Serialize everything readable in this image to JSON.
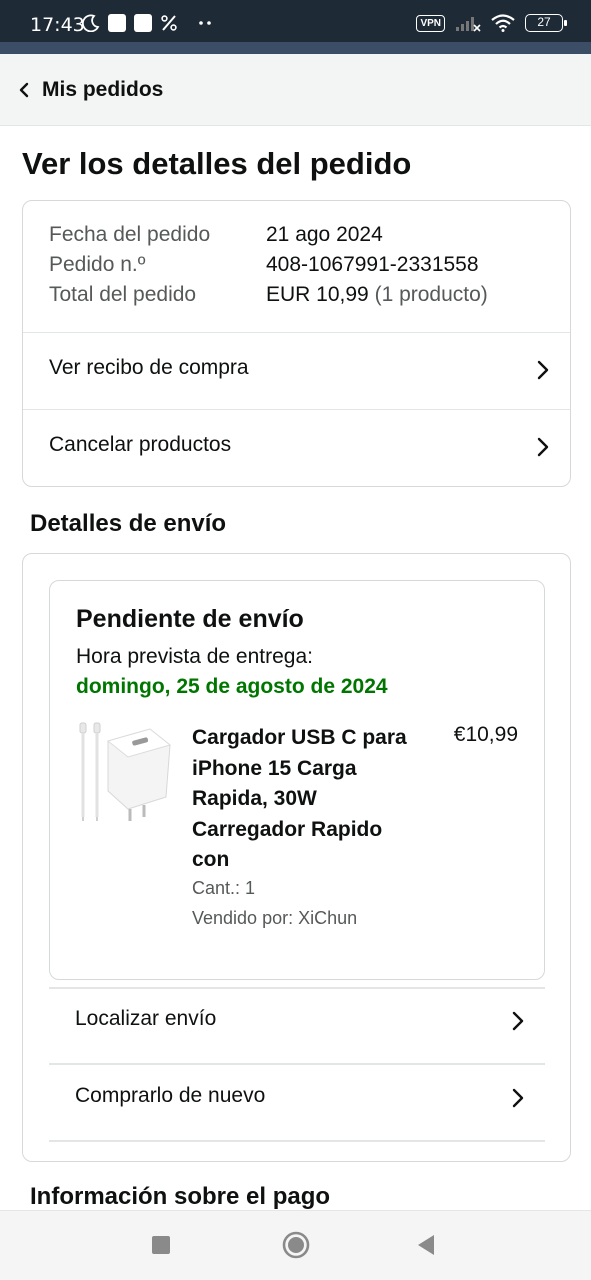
{
  "status_bar": {
    "time": "17:43",
    "vpn_label": "VPN",
    "battery": "27",
    "icons": [
      "moon-icon",
      "notification-square-icon",
      "notification-square-icon",
      "percent-icon",
      "more-dots-icon",
      "signal-icon",
      "wifi-icon",
      "battery-icon"
    ]
  },
  "header": {
    "back_label": "Mis pedidos"
  },
  "page": {
    "title": "Ver los detalles del pedido"
  },
  "order_summary": {
    "rows": [
      {
        "label": "Fecha del pedido",
        "value": "21 ago 2024",
        "extra": ""
      },
      {
        "label": "Pedido n.º",
        "value": "408-1067991-2331558",
        "extra": ""
      },
      {
        "label": "Total del pedido",
        "value": "EUR 10,99",
        "extra": "(1 producto)"
      }
    ],
    "links": [
      "Ver recibo de compra",
      "Cancelar productos"
    ]
  },
  "shipping": {
    "section_title": "Detalles de envío",
    "status": "Pendiente de envío",
    "eta_label": "Hora prevista de entrega:",
    "eta_date": "domingo, 25 de agosto de 2024",
    "product": {
      "title": "Cargador USB C para iPhone 15 Carga Rapida, 30W Carregador Rapido con",
      "price": "€10,99",
      "qty": "Cant.: 1",
      "seller": "Vendido por: XiChun"
    },
    "links": [
      "Localizar envío",
      "Comprarlo de nuevo"
    ]
  },
  "payment": {
    "section_title": "Información sobre el pago"
  },
  "colors": {
    "eta_green": "#007600",
    "status_bar_bg": "#1f2a37"
  }
}
